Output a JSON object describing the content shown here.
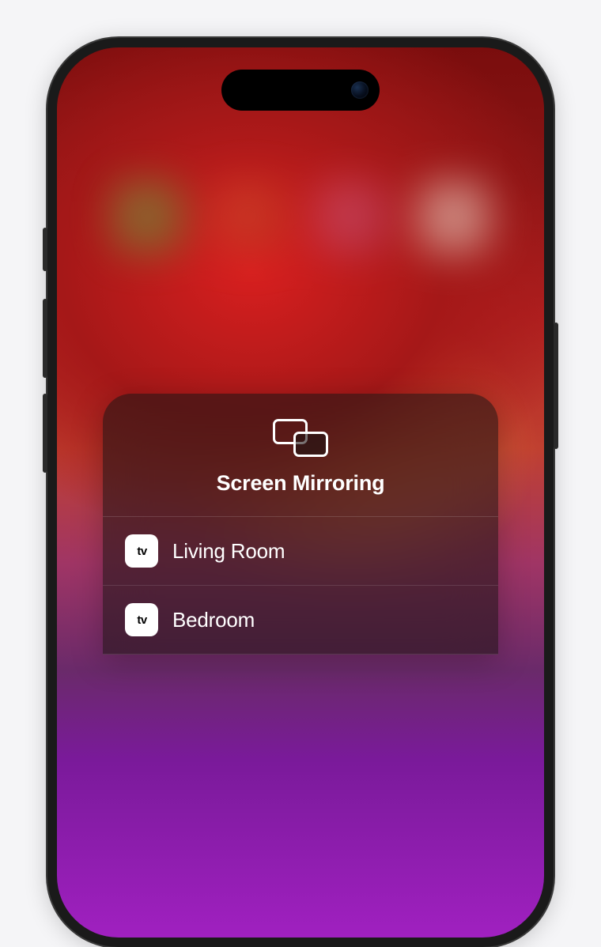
{
  "panel": {
    "title": "Screen Mirroring",
    "devices": [
      {
        "type": "apple-tv",
        "label": "Living Room"
      },
      {
        "type": "apple-tv",
        "label": "Bedroom"
      }
    ]
  },
  "icons": {
    "appletv_tv": "tv"
  }
}
